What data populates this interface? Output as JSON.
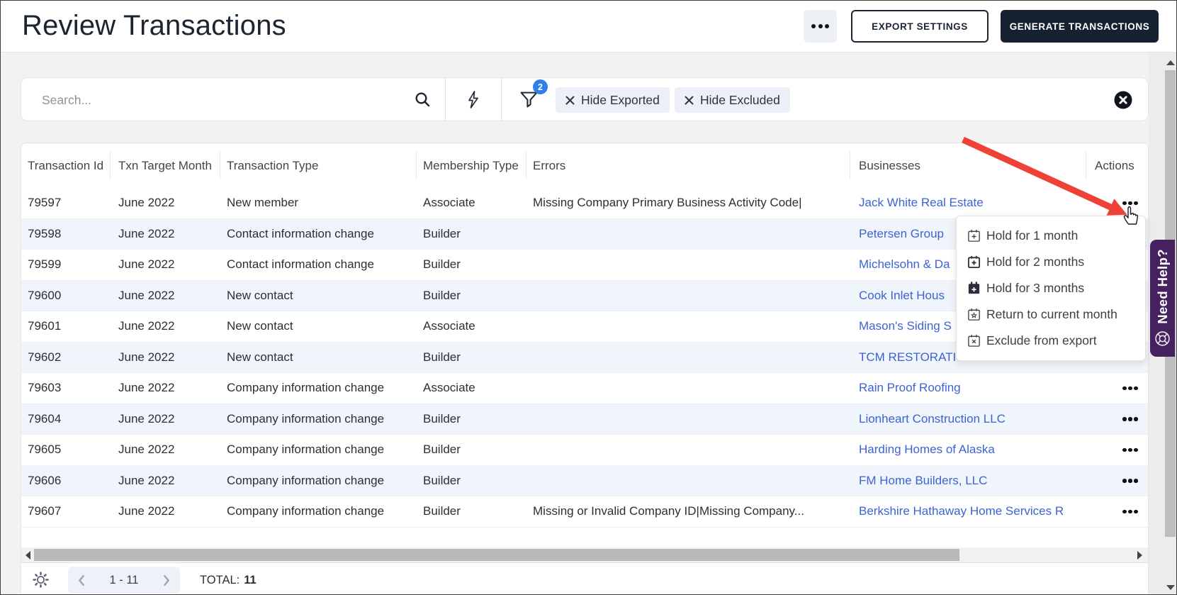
{
  "header": {
    "title": "Review Transactions",
    "export_settings_label": "EXPORT SETTINGS",
    "generate_label": "GENERATE TRANSACTIONS"
  },
  "search": {
    "placeholder": "Search...",
    "filter_count": "2",
    "chips": [
      {
        "label": "Hide Exported"
      },
      {
        "label": "Hide Excluded"
      }
    ]
  },
  "table": {
    "columns": [
      "Transaction Id",
      "Txn Target Month",
      "Transaction Type",
      "Membership Type",
      "Errors",
      "Businesses",
      "Actions"
    ],
    "rows": [
      {
        "id": "79597",
        "month": "June 2022",
        "type": "New member",
        "membership": "Associate",
        "errors": "Missing Company Primary Business Activity Code|",
        "business": "Jack White Real Estate"
      },
      {
        "id": "79598",
        "month": "June 2022",
        "type": "Contact information change",
        "membership": "Builder",
        "errors": "",
        "business": "Petersen Group"
      },
      {
        "id": "79599",
        "month": "June 2022",
        "type": "Contact information change",
        "membership": "Builder",
        "errors": "",
        "business": "Michelsohn & Da"
      },
      {
        "id": "79600",
        "month": "June 2022",
        "type": "New contact",
        "membership": "Builder",
        "errors": "",
        "business": "Cook Inlet Hous"
      },
      {
        "id": "79601",
        "month": "June 2022",
        "type": "New contact",
        "membership": "Associate",
        "errors": "",
        "business": "Mason's Siding S"
      },
      {
        "id": "79602",
        "month": "June 2022",
        "type": "New contact",
        "membership": "Builder",
        "errors": "",
        "business": "TCM RESTORATION"
      },
      {
        "id": "79603",
        "month": "June 2022",
        "type": "Company information change",
        "membership": "Associate",
        "errors": "",
        "business": "Rain Proof Roofing"
      },
      {
        "id": "79604",
        "month": "June 2022",
        "type": "Company information change",
        "membership": "Builder",
        "errors": "",
        "business": "Lionheart Construction LLC"
      },
      {
        "id": "79605",
        "month": "June 2022",
        "type": "Company information change",
        "membership": "Builder",
        "errors": "",
        "business": "Harding Homes of Alaska"
      },
      {
        "id": "79606",
        "month": "June 2022",
        "type": "Company information change",
        "membership": "Builder",
        "errors": "",
        "business": "FM Home Builders, LLC"
      },
      {
        "id": "79607",
        "month": "June 2022",
        "type": "Company information change",
        "membership": "Builder",
        "errors": "Missing or Invalid Company ID|Missing Company...",
        "business": "Berkshire Hathaway Home Services R"
      }
    ]
  },
  "context_menu": {
    "items": [
      {
        "label": "Hold for 1 month",
        "icon": "calendar-plus-icon"
      },
      {
        "label": "Hold for 2 months",
        "icon": "calendar-plus-bold-icon"
      },
      {
        "label": "Hold for 3 months",
        "icon": "calendar-plus-filled-icon"
      },
      {
        "label": "Return to current month",
        "icon": "calendar-star-icon"
      },
      {
        "label": "Exclude from export",
        "icon": "calendar-x-icon"
      }
    ]
  },
  "footer": {
    "page_range": "1 - 11",
    "total_label": "TOTAL:",
    "total_value": "11"
  },
  "help_tab": {
    "label": "Need Help?"
  },
  "icons": {
    "more": "kebab-horizontal-icon",
    "search": "magnifier-icon",
    "quick_filter": "lightning-bolt-icon",
    "filters": "funnel-icon",
    "chip_remove": "close-x-icon",
    "clear_search": "circle-x-icon",
    "settings": "gear-icon",
    "help": "lifebuoy-icon",
    "row_actions": "kebab-horizontal-icon"
  },
  "colors": {
    "brand_dark": "#162130",
    "link_blue": "#3d63d2",
    "badge_blue": "#2e7fe8",
    "row_alt": "#eff5fa",
    "help_purple": "#46215f",
    "annotation_red": "#ee4237"
  }
}
